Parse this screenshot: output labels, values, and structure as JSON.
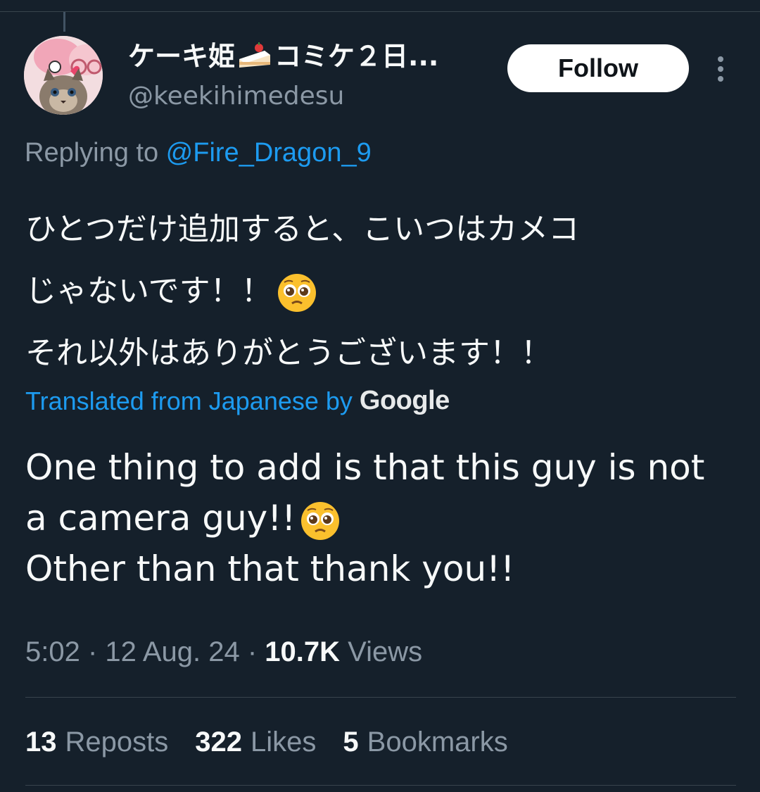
{
  "tweet": {
    "author": {
      "display_name": "ケーキ姫",
      "display_name_suffix": "コミケ２日...",
      "handle": "@keekihimedesu",
      "avatar": "avatar-image",
      "name_emoji": "cake-icon"
    },
    "follow_label": "Follow",
    "more_icon": "more-vertical-icon",
    "replying_prefix": "Replying to ",
    "replying_mention": "@Fire_Dragon_9",
    "original_lines": [
      "ひとつだけ追加すると、こいつはカメコ",
      "じゃないです！！",
      "それ以外はありがとうございます！！"
    ],
    "translated_from": "Translated from Japanese by",
    "translator": "Google",
    "translation_lines": [
      "One thing to add is that this guy is not",
      "a camera guy!!",
      "Other than that thank you!!"
    ],
    "time": "5:02",
    "date": "12 Aug. 24",
    "views_count": "10.7K",
    "views_label": "Views",
    "stats": {
      "reposts_count": "13",
      "reposts_label": "Reposts",
      "likes_count": "322",
      "likes_label": "Likes",
      "bookmarks_count": "5",
      "bookmarks_label": "Bookmarks"
    }
  },
  "colors": {
    "background": "#15202b",
    "text": "#f7f9f9",
    "secondary": "#8b98a5",
    "accent": "#1d9bf0",
    "divider": "#38444d"
  }
}
